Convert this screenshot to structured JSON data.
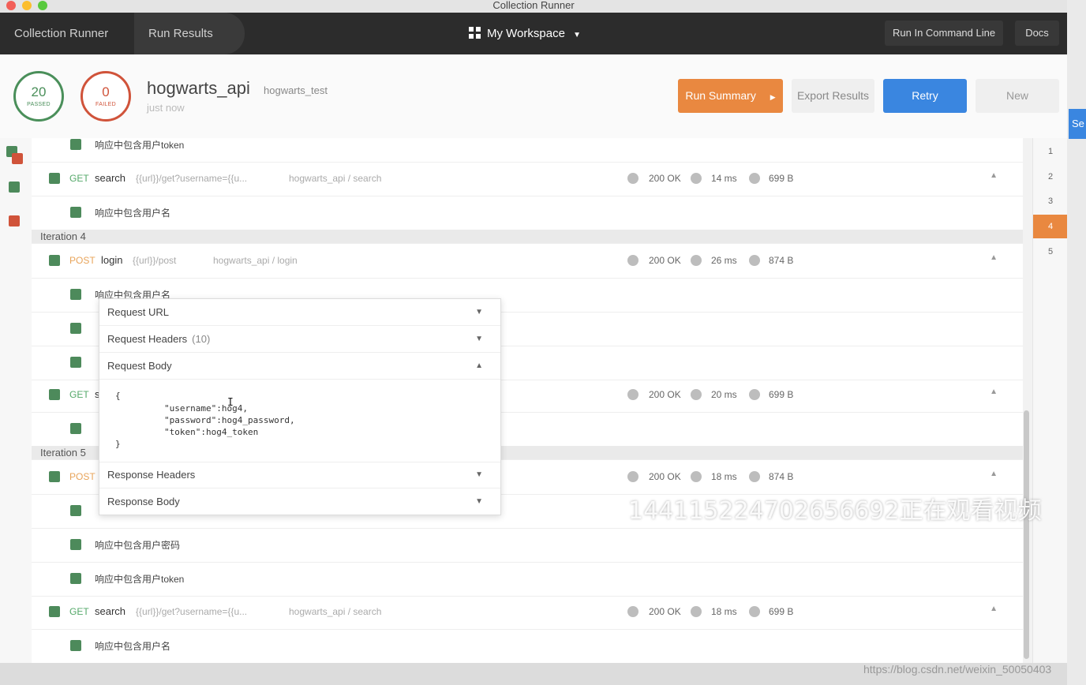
{
  "window": {
    "title": "Collection Runner"
  },
  "header": {
    "tabs": [
      "Collection Runner",
      "Run Results"
    ],
    "workspace": "My Workspace",
    "run_cli": "Run In Command Line",
    "docs": "Docs"
  },
  "summary": {
    "passed": {
      "count": "20",
      "label": "PASSED"
    },
    "failed": {
      "count": "0",
      "label": "FAILED"
    },
    "collection": "hogwarts_api",
    "environment": "hogwarts_test",
    "time": "just now",
    "buttons": {
      "run_summary": "Run Summary",
      "export": "Export Results",
      "retry": "Retry",
      "new": "New"
    }
  },
  "rows": {
    "a0": "响应中包含用户token",
    "r1": {
      "method": "GET",
      "name": "search",
      "url": "{{url}}/get?username={{u...",
      "path": "hogwarts_api / search",
      "status": "200 OK",
      "time": "14 ms",
      "size": "699 B"
    },
    "a1": "响应中包含用户名",
    "iter4": "Iteration 4",
    "r2": {
      "method": "POST",
      "name": "login",
      "url": "{{url}}/post",
      "path": "hogwarts_api / login",
      "status": "200 OK",
      "time": "26 ms",
      "size": "874 B"
    },
    "a2": "响应中包含用户名",
    "r3": {
      "method": "GET",
      "name": "s",
      "status": "200 OK",
      "time": "20 ms",
      "size": "699 B"
    },
    "iter5": "Iteration 5",
    "r4": {
      "method": "POST",
      "status": "200 OK",
      "time": "18 ms",
      "size": "874 B"
    },
    "a5": "响应中包含用户密码",
    "a6": "响应中包含用户token",
    "r5": {
      "method": "GET",
      "name": "search",
      "url": "{{url}}/get?username={{u...",
      "path": "hogwarts_api / search",
      "status": "200 OK",
      "time": "18 ms",
      "size": "699 B"
    },
    "a7": "响应中包含用户名"
  },
  "iterations": [
    "1",
    "2",
    "3",
    "4",
    "5"
  ],
  "popover": {
    "request_url": "Request URL",
    "request_headers": "Request Headers",
    "request_headers_count": "(10)",
    "request_body": "Request Body",
    "body_lines": [
      "{",
      "\"username\":hog4,",
      "\"password\":hog4_password,",
      "\"token\":hog4_token",
      "}"
    ],
    "response_headers": "Response Headers",
    "response_body": "Response Body"
  },
  "overlay": {
    "watermark": "144115224702656692正在观看视频",
    "url": "https://blog.csdn.net/weixin_50050403",
    "right_button": "Se"
  },
  "colors": {
    "accent_orange": "#e98840",
    "accent_blue": "#3a86e0",
    "pass_green": "#4a8f5a",
    "fail_red": "#d0533a"
  }
}
